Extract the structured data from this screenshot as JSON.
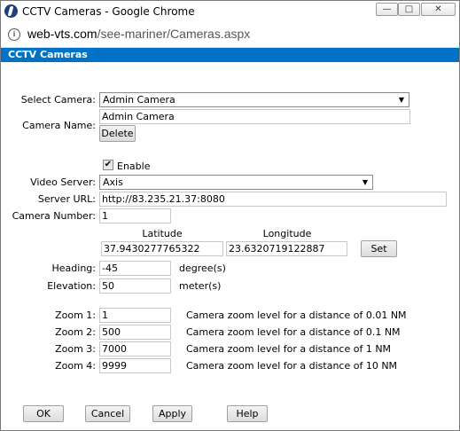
{
  "window": {
    "title": "CCTV Cameras - Google Chrome",
    "minimize": "—",
    "maximize": "□",
    "close": "✕",
    "url_host": "web-vts.com",
    "url_path": "/see-mariner/Cameras.aspx"
  },
  "header": {
    "title": "CCTV Cameras"
  },
  "form": {
    "select_camera_label": "Select Camera:",
    "select_camera_value": "Admin Camera",
    "camera_name_label": "Camera Name:",
    "camera_name_value": "Admin Camera",
    "delete_label": "Delete",
    "enable_label": "Enable",
    "enable_checked": true,
    "video_server_label": "Video Server:",
    "video_server_value": "Axis",
    "server_url_label": "Server URL:",
    "server_url_value": "http://83.235.21.37:8080",
    "camera_number_label": "Camera Number:",
    "camera_number_value": "1",
    "latitude_label": "Latitude",
    "longitude_label": "Longitude",
    "latitude_value": "37.9430277765322",
    "longitude_value": "23.6320719122887",
    "set_label": "Set",
    "heading_label": "Heading:",
    "heading_value": "-45",
    "heading_unit": "degree(s)",
    "elevation_label": "Elevation:",
    "elevation_value": "50",
    "elevation_unit": "meter(s)"
  },
  "zoom": [
    {
      "label": "Zoom 1:",
      "value": "1",
      "desc": "Camera zoom level for a distance of 0.01 NM"
    },
    {
      "label": "Zoom 2:",
      "value": "500",
      "desc": "Camera zoom level for a distance of 0.1 NM"
    },
    {
      "label": "Zoom 3:",
      "value": "7000",
      "desc": "Camera zoom level for a distance of 1 NM"
    },
    {
      "label": "Zoom 4:",
      "value": "9999",
      "desc": "Camera zoom level for a distance of 10 NM"
    }
  ],
  "buttons": {
    "ok": "OK",
    "cancel": "Cancel",
    "apply": "Apply",
    "help": "Help"
  },
  "colors": {
    "header_bg": "#0072c6"
  }
}
